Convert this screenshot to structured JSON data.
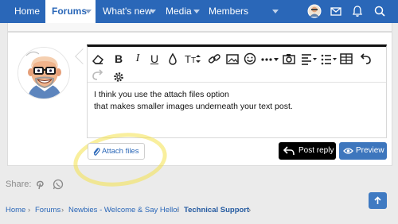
{
  "nav": {
    "home": "Home",
    "forums": "Forums",
    "whats_new": "What's new",
    "media": "Media",
    "members": "Members"
  },
  "editor": {
    "line1": "I think you use the attach files option",
    "line2": "that makes smaller images underneath your text post."
  },
  "buttons": {
    "attach_files": "Attach files",
    "post_reply": "Post reply",
    "preview": "Preview"
  },
  "share": {
    "label": "Share:"
  },
  "breadcrumb": {
    "items": [
      "Home",
      "Forums",
      "Newbies - Welcome & Say Hello!",
      "Technical Support"
    ]
  }
}
